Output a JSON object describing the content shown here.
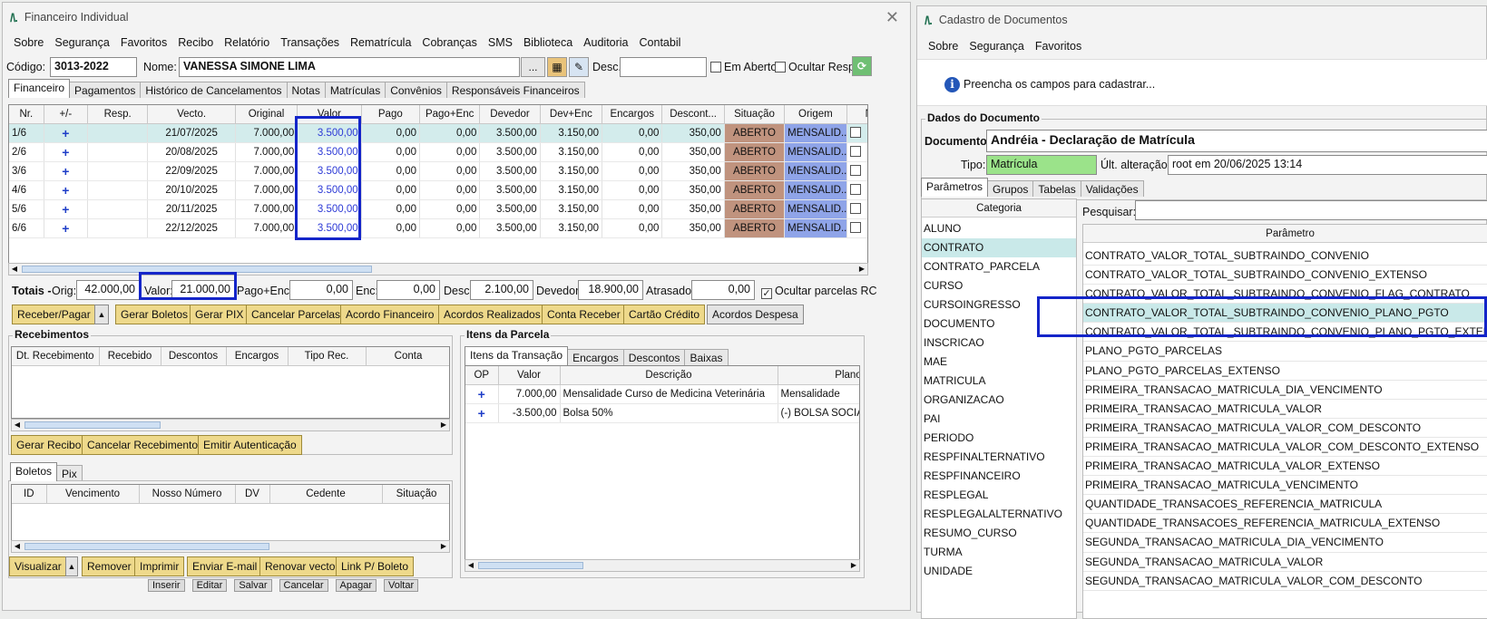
{
  "win1": {
    "title": "Financeiro Individual",
    "logo": "/\\.",
    "menu": [
      "Sobre",
      "Segurança",
      "Favoritos",
      "Recibo",
      "Relatório",
      "Transações",
      "Rematrícula",
      "Cobranças",
      "SMS",
      "Biblioteca",
      "Auditoria",
      "Contabil"
    ],
    "codigo_label": "Código:",
    "codigo_value": "3013-2022",
    "nome_label": "Nome:",
    "nome_value": "VANESSA SIMONE LIMA",
    "ellipsis": "...",
    "desc_label": "Desc.:",
    "desc_value": "",
    "em_aberto": "Em Aberto",
    "ocultar_resp": "Ocultar Resp.",
    "tabs": [
      "Financeiro",
      "Pagamentos",
      "Histórico de Cancelamentos",
      "Notas",
      "Matrículas",
      "Convênios",
      "Responsáveis Financeiros"
    ],
    "grid_headers": [
      "Nr.",
      "+/-",
      "Resp.",
      "Vecto.",
      "Original",
      "Valor",
      "Pago",
      "Pago+Enc",
      "Devedor",
      "Dev+Enc",
      "Encargos",
      "Descont...",
      "Situação",
      "Origem",
      "NF"
    ],
    "rows": [
      {
        "nr": "1/6",
        "pm": "+",
        "resp": "",
        "vecto": "21/07/2025",
        "orig": "7.000,00",
        "valor": "3.500,00",
        "pago": "0,00",
        "pagoenc": "0,00",
        "devedor": "3.500,00",
        "devenc": "3.150,00",
        "enc": "0,00",
        "desc": "350,00",
        "sit": "ABERTO",
        "origem": "MENSALID..."
      },
      {
        "nr": "2/6",
        "pm": "+",
        "resp": "",
        "vecto": "20/08/2025",
        "orig": "7.000,00",
        "valor": "3.500,00",
        "pago": "0,00",
        "pagoenc": "0,00",
        "devedor": "3.500,00",
        "devenc": "3.150,00",
        "enc": "0,00",
        "desc": "350,00",
        "sit": "ABERTO",
        "origem": "MENSALID..."
      },
      {
        "nr": "3/6",
        "pm": "+",
        "resp": "",
        "vecto": "22/09/2025",
        "orig": "7.000,00",
        "valor": "3.500,00",
        "pago": "0,00",
        "pagoenc": "0,00",
        "devedor": "3.500,00",
        "devenc": "3.150,00",
        "enc": "0,00",
        "desc": "350,00",
        "sit": "ABERTO",
        "origem": "MENSALID..."
      },
      {
        "nr": "4/6",
        "pm": "+",
        "resp": "",
        "vecto": "20/10/2025",
        "orig": "7.000,00",
        "valor": "3.500,00",
        "pago": "0,00",
        "pagoenc": "0,00",
        "devedor": "3.500,00",
        "devenc": "3.150,00",
        "enc": "0,00",
        "desc": "350,00",
        "sit": "ABERTO",
        "origem": "MENSALID..."
      },
      {
        "nr": "5/6",
        "pm": "+",
        "resp": "",
        "vecto": "20/11/2025",
        "orig": "7.000,00",
        "valor": "3.500,00",
        "pago": "0,00",
        "pagoenc": "0,00",
        "devedor": "3.500,00",
        "devenc": "3.150,00",
        "enc": "0,00",
        "desc": "350,00",
        "sit": "ABERTO",
        "origem": "MENSALID..."
      },
      {
        "nr": "6/6",
        "pm": "+",
        "resp": "",
        "vecto": "22/12/2025",
        "orig": "7.000,00",
        "valor": "3.500,00",
        "pago": "0,00",
        "pagoenc": "0,00",
        "devedor": "3.500,00",
        "devenc": "3.150,00",
        "enc": "0,00",
        "desc": "350,00",
        "sit": "ABERTO",
        "origem": "MENSALID..."
      }
    ],
    "totais": {
      "label": "Totais -",
      "orig_label": "Orig:",
      "orig": "42.000,00",
      "valor_label": "Valor:",
      "valor": "21.000,00",
      "pagoenc_label": "Pago+Enc:",
      "pagoenc": "0,00",
      "enc_label": "Enc:",
      "enc": "0,00",
      "desc_label": "Desc:",
      "desc": "2.100,00",
      "devedor_label": "Devedor:",
      "devedor": "18.900,00",
      "atrasado_label": "Atrasado:",
      "atrasado": "0,00",
      "ocultar_label": "Ocultar parcelas RC"
    },
    "actions": [
      "Receber/Pagar",
      "Gerar Boletos",
      "Gerar PIX",
      "Cancelar Parcelas",
      "Acordo Financeiro",
      "Acordos Realizados",
      "Conta Receber",
      "Cartão Crédito",
      "Acordos Despesa"
    ],
    "recebimentos": {
      "title": "Recebimentos",
      "headers": [
        "Dt. Recebimento",
        "Recebido",
        "Descontos",
        "Encargos",
        "Tipo Rec.",
        "Conta"
      ],
      "buttons": [
        "Gerar Recibo",
        "Cancelar Recebimento",
        "Emitir Autenticação"
      ]
    },
    "boletos": {
      "tabs": [
        "Boletos",
        "Pix"
      ],
      "headers": [
        "ID",
        "Vencimento",
        "Nosso Número",
        "DV",
        "Cedente",
        "Situação"
      ],
      "buttons": [
        "Visualizar",
        "Remover",
        "Imprimir",
        "Enviar E-mail",
        "Renovar vecto",
        "Link P/ Boleto"
      ]
    },
    "itens": {
      "title": "Itens da Parcela",
      "tabs": [
        "Itens da Transação",
        "Encargos",
        "Descontos",
        "Baixas"
      ],
      "headers": [
        "OP",
        "Valor",
        "Descrição",
        "Plano"
      ],
      "rows": [
        {
          "op": "+",
          "valor": "7.000,00",
          "desc": "Mensalidade Curso de Medicina Veterinária",
          "plano": "Mensalidade"
        },
        {
          "op": "+",
          "valor": "-3.500,00",
          "desc": "Bolsa 50%",
          "plano": "(-) BOLSA SOCIAL"
        }
      ]
    },
    "bottom_peek": [
      "Inserir",
      "Editar",
      "Salvar",
      "Cancelar",
      "Apagar",
      "Voltar"
    ]
  },
  "win2": {
    "title": "Cadastro de Documentos",
    "menu": [
      "Sobre",
      "Segurança",
      "Favoritos"
    ],
    "info": "Preencha os campos para cadastrar...",
    "group_title": "Dados do Documento",
    "documento_label": "Documento:",
    "documento_value": "Andréia - Declaração de Matrícula",
    "tipo_label": "Tipo:",
    "tipo_value": "Matrícula",
    "ult_label": "Últ. alteração:",
    "ult_value": "root em 20/06/2025 13:14",
    "tabs": [
      "Parâmetros",
      "Grupos",
      "Tabelas",
      "Validações"
    ],
    "categoria_header": "Categoria",
    "categorias": [
      "ALUNO",
      "CONTRATO",
      "CONTRATO_PARCELA",
      "CURSO",
      "CURSOINGRESSO",
      "DOCUMENTO",
      "INSCRICAO",
      "MAE",
      "MATRICULA",
      "ORGANIZACAO",
      "PAI",
      "PERIODO",
      "RESPFINALTERNATIVO",
      "RESPFINANCEIRO",
      "RESPLEGAL",
      "RESPLEGALALTERNATIVO",
      "RESUMO_CURSO",
      "TURMA",
      "UNIDADE"
    ],
    "pesquisar_label": "Pesquisar:",
    "parametro_header": "Parâmetro",
    "parametros": [
      "CONTRATO_VALOR_TOTAL_SUBTRAINDO_CONVENIO",
      "CONTRATO_VALOR_TOTAL_SUBTRAINDO_CONVENIO_EXTENSO",
      "CONTRATO_VALOR_TOTAL_SUBTRAINDO_CONVENIO_FLAG_CONTRATO",
      "CONTRATO_VALOR_TOTAL_SUBTRAINDO_CONVENIO_PLANO_PGTO",
      "CONTRATO_VALOR_TOTAL_SUBTRAINDO_CONVENIO_PLANO_PGTO_EXTENSO",
      "PLANO_PGTO_PARCELAS",
      "PLANO_PGTO_PARCELAS_EXTENSO",
      "PRIMEIRA_TRANSACAO_MATRICULA_DIA_VENCIMENTO",
      "PRIMEIRA_TRANSACAO_MATRICULA_VALOR",
      "PRIMEIRA_TRANSACAO_MATRICULA_VALOR_COM_DESCONTO",
      "PRIMEIRA_TRANSACAO_MATRICULA_VALOR_COM_DESCONTO_EXTENSO",
      "PRIMEIRA_TRANSACAO_MATRICULA_VALOR_EXTENSO",
      "PRIMEIRA_TRANSACAO_MATRICULA_VENCIMENTO",
      "QUANTIDADE_TRANSACOES_REFERENCIA_MATRICULA",
      "QUANTIDADE_TRANSACOES_REFERENCIA_MATRICULA_EXTENSO",
      "SEGUNDA_TRANSACAO_MATRICULA_DIA_VENCIMENTO",
      "SEGUNDA_TRANSACAO_MATRICULA_VALOR",
      "SEGUNDA_TRANSACAO_MATRICULA_VALOR_COM_DESCONTO"
    ]
  },
  "colors": {
    "highlight": "#1425c9",
    "aberto": "#c0937e",
    "mensalid": "#8fa4e8",
    "selected_row": "#d3ecec",
    "tipo_bg": "#9be38a"
  }
}
